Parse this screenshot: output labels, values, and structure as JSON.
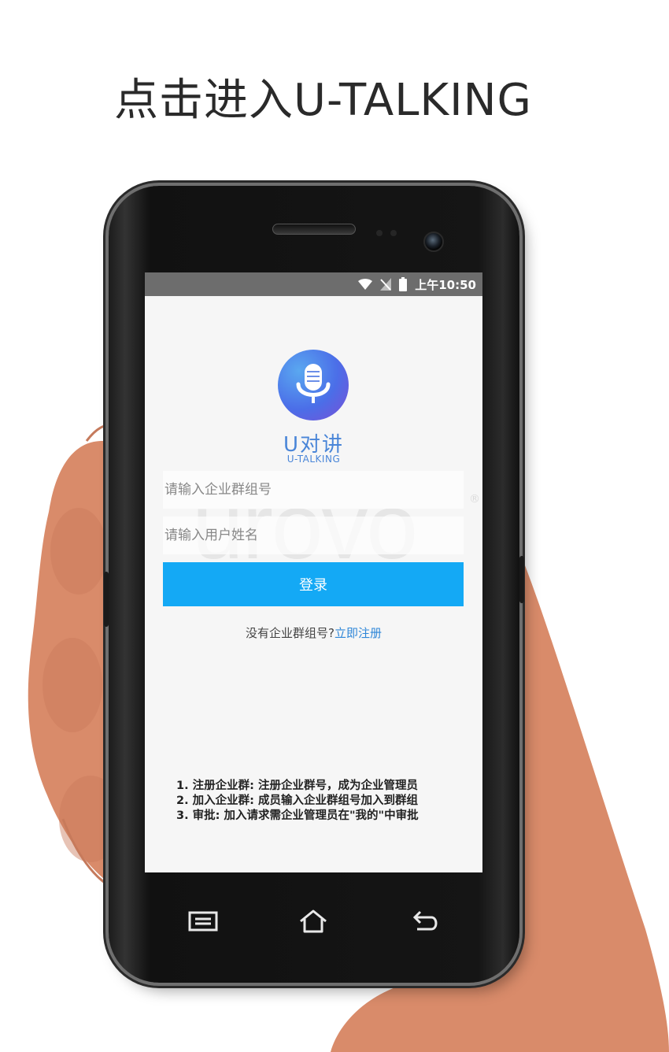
{
  "header": {
    "title": "点击进入U-TALKING"
  },
  "status_bar": {
    "time": "上午10:50",
    "icons": [
      "wifi-icon",
      "no-signal-icon",
      "battery-icon"
    ]
  },
  "app": {
    "name": "U对讲",
    "subtitle": "U-TALKING"
  },
  "watermark": {
    "text": "urovo",
    "mark": "®"
  },
  "login_form": {
    "group_placeholder": "请输入企业群组号",
    "user_placeholder": "请输入用户姓名",
    "login_button": "登录",
    "no_group_text": "没有企业群组号?",
    "register_link": "立即注册"
  },
  "help": {
    "lines": [
      "1. 注册企业群: 注册企业群号，成为企业管理员",
      "2. 加入企业群: 成员输入企业群组号加入到群组",
      "3. 审批: 加入请求需企业管理员在\"我的\"中审批"
    ]
  },
  "nav": {
    "icons": [
      "menu-icon",
      "home-icon",
      "back-icon"
    ]
  },
  "colors": {
    "accent": "#14a9f5",
    "link": "#2f87d8",
    "skin": "#d98b6a"
  }
}
